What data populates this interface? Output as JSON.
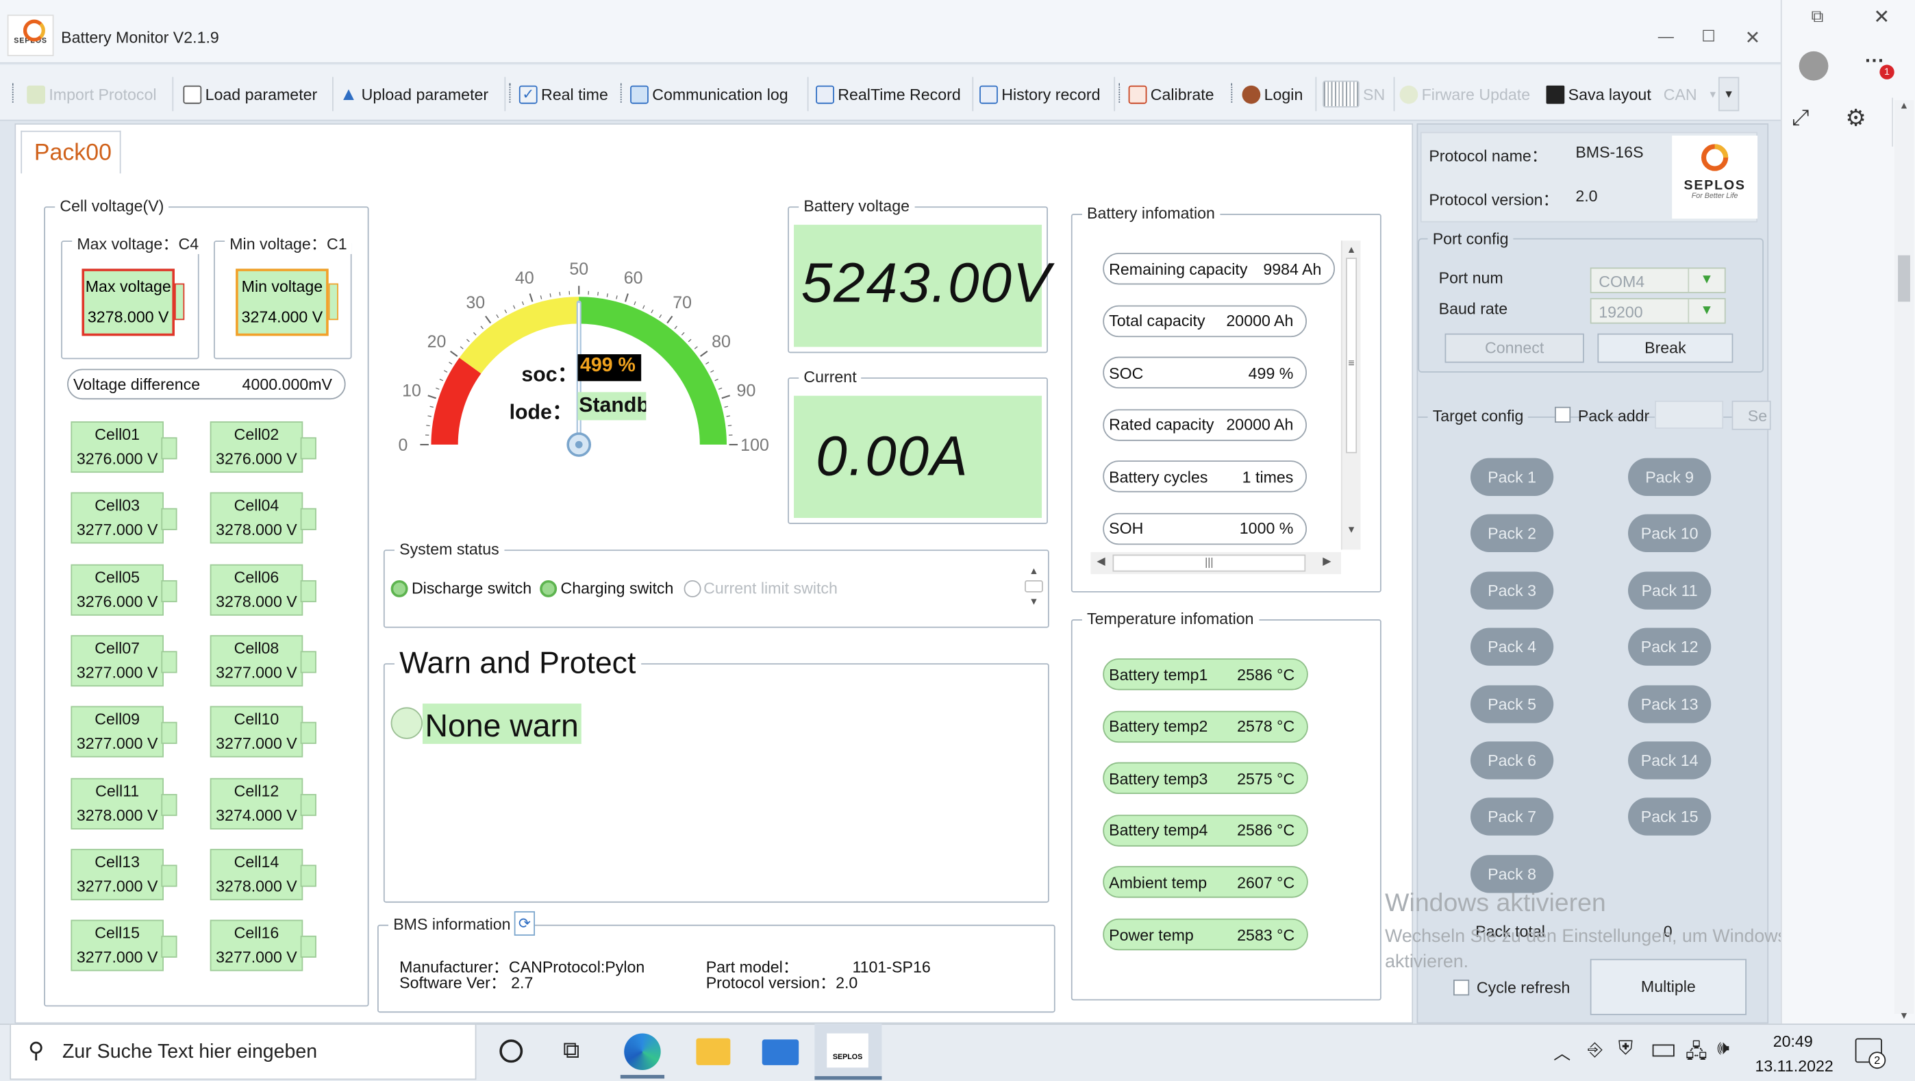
{
  "window": {
    "title": "Battery Monitor V2.1.9",
    "logo_text": "SEPLOS"
  },
  "toolbar": {
    "import_protocol": "Import Protocol",
    "load_parameter": "Load parameter",
    "upload_parameter": "Upload parameter",
    "real_time": "Real time",
    "communication_log": "Communication log",
    "realtime_record": "RealTime Record",
    "history_record": "History record",
    "calibrate": "Calibrate",
    "login": "Login",
    "sn": "SN",
    "firmware_update": "Firware Update",
    "save_layout": "Sava layout",
    "can": "CAN"
  },
  "tab": {
    "label": "Pack00"
  },
  "cell_voltage": {
    "group_label": "Cell voltage(V)",
    "max_group": "Max voltage：C4",
    "min_group": "Min voltage：C1",
    "max_label": "Max voltage",
    "max_value": "3278.000 V",
    "min_label": "Min voltage",
    "min_value": "3274.000 V",
    "diff_label": "Voltage difference",
    "diff_value": "4000.000mV",
    "cells": [
      {
        "name": "Cell01",
        "value": "3276.000 V"
      },
      {
        "name": "Cell02",
        "value": "3276.000 V"
      },
      {
        "name": "Cell03",
        "value": "3277.000 V"
      },
      {
        "name": "Cell04",
        "value": "3278.000 V"
      },
      {
        "name": "Cell05",
        "value": "3276.000 V"
      },
      {
        "name": "Cell06",
        "value": "3278.000 V"
      },
      {
        "name": "Cell07",
        "value": "3277.000 V"
      },
      {
        "name": "Cell08",
        "value": "3277.000 V"
      },
      {
        "name": "Cell09",
        "value": "3277.000 V"
      },
      {
        "name": "Cell10",
        "value": "3277.000 V"
      },
      {
        "name": "Cell11",
        "value": "3278.000 V"
      },
      {
        "name": "Cell12",
        "value": "3274.000 V"
      },
      {
        "name": "Cell13",
        "value": "3277.000 V"
      },
      {
        "name": "Cell14",
        "value": "3278.000 V"
      },
      {
        "name": "Cell15",
        "value": "3277.000 V"
      },
      {
        "name": "Cell16",
        "value": "3277.000 V"
      }
    ]
  },
  "gauge": {
    "soc_label": "soc：",
    "soc_value": "499 %",
    "mode_label": "lode：",
    "mode_value": "Standb",
    "ticks": [
      "0",
      "10",
      "20",
      "30",
      "40",
      "50",
      "60",
      "70",
      "80",
      "90",
      "100"
    ],
    "needle_value": 50
  },
  "battery_voltage": {
    "label": "Battery voltage",
    "value": "5243.00V"
  },
  "current": {
    "label": "Current",
    "value": "0.00A"
  },
  "battery_info": {
    "label": "Battery infomation",
    "items": [
      {
        "label": "Remaining capacity",
        "value": "9984 Ah"
      },
      {
        "label": "Total capacity",
        "value": "20000 Ah"
      },
      {
        "label": "SOC",
        "value": "499 %"
      },
      {
        "label": "Rated capacity",
        "value": "20000 Ah"
      },
      {
        "label": "Battery cycles",
        "value": "1 times"
      },
      {
        "label": "SOH",
        "value": "1000 %"
      }
    ]
  },
  "system_status": {
    "label": "System status",
    "discharge": "Discharge switch",
    "charging": "Charging switch",
    "current_limit": "Current limit switch"
  },
  "warn": {
    "label": "Warn and Protect",
    "value": "None warn"
  },
  "bms": {
    "label": "BMS information",
    "manufacturer_label": "Manufacturer：",
    "manufacturer_value": "CANProtocol:Pylon",
    "software_label": "Software Ver：",
    "software_value": "2.7",
    "part_label": "Part model：",
    "part_value": "1101-SP16",
    "protocol_label": "Protocol version：",
    "protocol_value": "2.0"
  },
  "temperature": {
    "label": "Temperature infomation",
    "items": [
      {
        "label": "Battery temp1",
        "value": "2586 °C"
      },
      {
        "label": "Battery temp2",
        "value": "2578 °C"
      },
      {
        "label": "Battery temp3",
        "value": "2575 °C"
      },
      {
        "label": "Battery temp4",
        "value": "2586 °C"
      },
      {
        "label": "Ambient temp",
        "value": "2607 °C"
      },
      {
        "label": "Power temp",
        "value": "2583 °C"
      }
    ]
  },
  "right_panel": {
    "protocol_name_label": "Protocol name：",
    "protocol_name_value": "BMS-16S",
    "protocol_version_label": "Protocol version：",
    "protocol_version_value": "2.0",
    "logo_text": "SEPLOS",
    "logo_sub": "For Better Life",
    "port_config": "Port config",
    "port_num_label": "Port num",
    "port_num_value": "COM4",
    "baud_label": "Baud rate",
    "baud_value": "19200",
    "connect": "Connect",
    "break": "Break",
    "target_config": "Target config",
    "pack_addr": "Pack addr",
    "se": "Se",
    "packs": [
      "Pack 1",
      "Pack 9",
      "Pack 2",
      "Pack 10",
      "Pack 3",
      "Pack 11",
      "Pack 4",
      "Pack 12",
      "Pack 5",
      "Pack 13",
      "Pack 6",
      "Pack 14",
      "Pack 7",
      "Pack 15",
      "Pack 8"
    ],
    "pack_total_label": "Pack total",
    "pack_total_value": "0",
    "cycle_refresh": "Cycle refresh",
    "multiple": "Multiple"
  },
  "watermark": {
    "title": "Windows aktivieren",
    "line1": "Wechseln Sie zu den Einstellungen, um Windows zu",
    "line2": "aktivieren."
  },
  "taskbar": {
    "search_placeholder": "Zur Suche Text hier eingeben",
    "time": "20:49",
    "date": "13.11.2022",
    "notification_count": "2"
  },
  "edge_panel": {
    "badge": "1"
  },
  "colors": {
    "accent_orange": "#d0611a",
    "panel_green": "#c5f1bf",
    "soc_text": "#f0a21e"
  }
}
